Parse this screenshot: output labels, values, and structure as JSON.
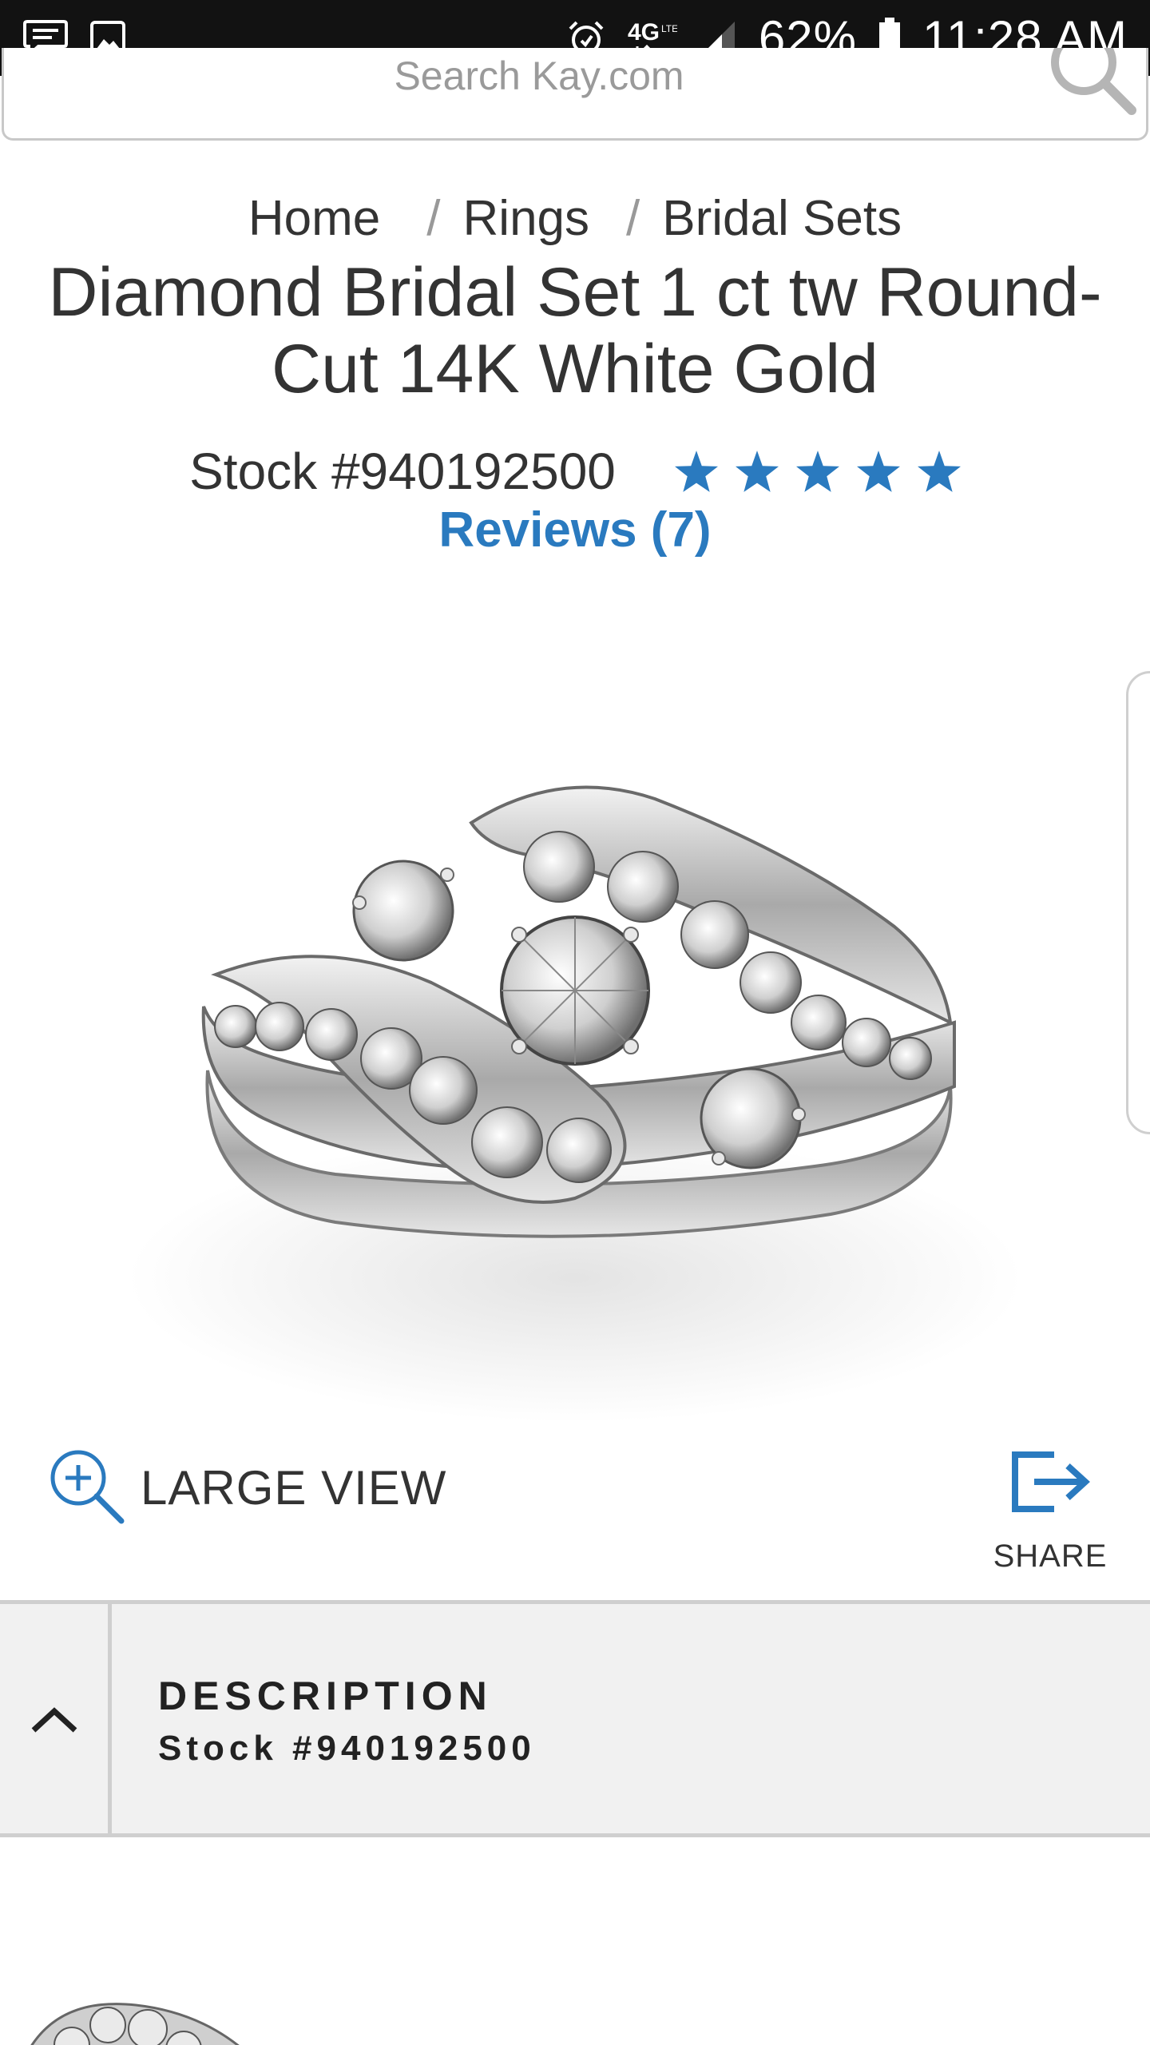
{
  "status_bar": {
    "battery": "62%",
    "time": "11:28 AM",
    "network": "4G LTE",
    "icons": [
      "message-icon",
      "image-icon",
      "alarm-icon",
      "network-4g-icon",
      "signal-icon",
      "battery-icon"
    ]
  },
  "search": {
    "placeholder": "Search Kay.com",
    "icon": "search-icon"
  },
  "breadcrumb": {
    "items": [
      "Home",
      "Rings",
      "Bridal Sets"
    ],
    "separator": "/"
  },
  "product": {
    "title": "Diamond Bridal Set 1 ct tw Round-Cut 14K White Gold",
    "stock": "Stock #940192500",
    "rating_stars": 5,
    "reviews_label": "Reviews (7)",
    "image": "diamond-bridal-set-ring"
  },
  "actions": {
    "large_view_label": "LARGE VIEW",
    "share_label": "SHARE"
  },
  "description": {
    "title": "DESCRIPTION",
    "stock": "Stock #940192500"
  },
  "colors": {
    "accent_blue": "#2a7abf",
    "status_bar": "#121212",
    "panel_bg": "#f1f1f1"
  }
}
